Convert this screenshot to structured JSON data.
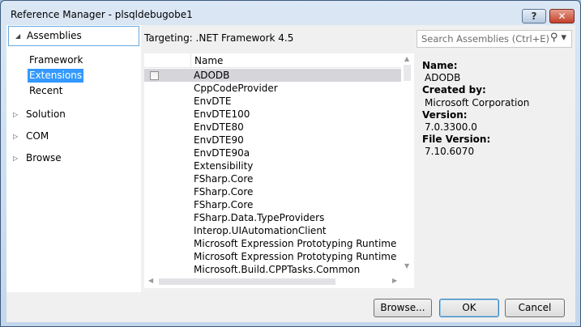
{
  "window": {
    "title": "Reference Manager - plsqldebugobe1",
    "help": "?",
    "close": "✕"
  },
  "nav": {
    "assemblies": "Assemblies",
    "sub": [
      "Framework",
      "Extensions",
      "Recent"
    ],
    "items": [
      "Solution",
      "COM",
      "Browse"
    ]
  },
  "targeting": "Targeting: .NET Framework 4.5",
  "search": {
    "placeholder": "Search Assemblies (Ctrl+E)"
  },
  "list": {
    "header": "Name",
    "rows": [
      "ADODB",
      "CppCodeProvider",
      "EnvDTE",
      "EnvDTE100",
      "EnvDTE80",
      "EnvDTE90",
      "EnvDTE90a",
      "Extensibility",
      "FSharp.Core",
      "FSharp.Core",
      "FSharp.Core",
      "FSharp.Data.TypeProviders",
      "Interop.UIAutomationClient",
      "Microsoft Expression Prototyping Runtime",
      "Microsoft Expression Prototyping Runtime",
      "Microsoft.Build.CPPTasks.Common"
    ]
  },
  "details": {
    "name_label": "Name:",
    "name": "ADODB",
    "created_label": "Created by:",
    "created": "Microsoft Corporation",
    "version_label": "Version:",
    "version": "7.0.3300.0",
    "file_version_label": "File Version:",
    "file_version": "7.10.6070"
  },
  "buttons": {
    "browse": "Browse...",
    "ok": "OK",
    "cancel": "Cancel"
  }
}
